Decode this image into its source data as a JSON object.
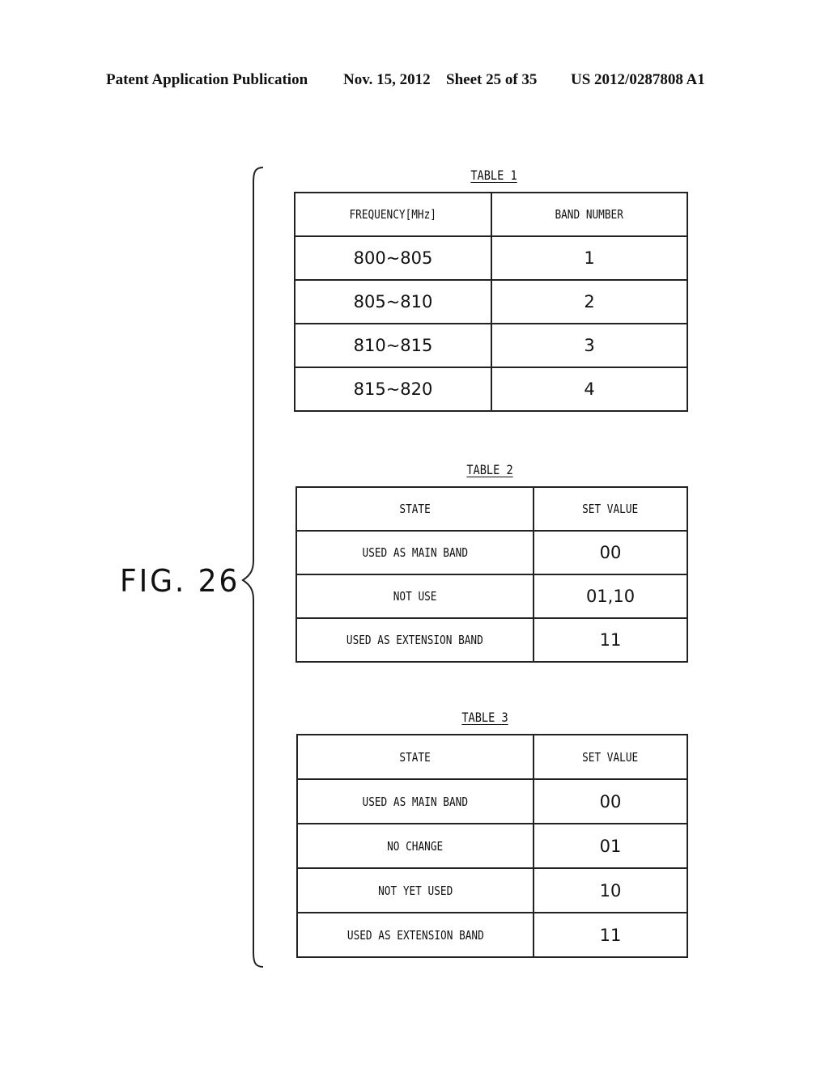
{
  "header": {
    "publication": "Patent Application Publication",
    "date": "Nov. 15, 2012",
    "sheet": "Sheet 25 of 35",
    "number": "US 2012/0287808 A1"
  },
  "figure": {
    "label": "FIG. 26"
  },
  "table1": {
    "title": "TABLE 1",
    "columns": [
      "FREQUENCY[MHz]",
      "BAND NUMBER"
    ],
    "rows": [
      [
        "800~805",
        "1"
      ],
      [
        "805~810",
        "2"
      ],
      [
        "810~815",
        "3"
      ],
      [
        "815~820",
        "4"
      ]
    ]
  },
  "table2": {
    "title": "TABLE 2",
    "columns": [
      "STATE",
      "SET VALUE"
    ],
    "rows": [
      [
        "USED AS MAIN BAND",
        "00"
      ],
      [
        "NOT USE",
        "01,10"
      ],
      [
        "USED AS EXTENSION BAND",
        "11"
      ]
    ]
  },
  "table3": {
    "title": "TABLE 3",
    "columns": [
      "STATE",
      "SET VALUE"
    ],
    "rows": [
      [
        "USED AS MAIN BAND",
        "00"
      ],
      [
        "NO CHANGE",
        "01"
      ],
      [
        "NOT YET USED",
        "10"
      ],
      [
        "USED AS EXTENSION BAND",
        "11"
      ]
    ]
  }
}
